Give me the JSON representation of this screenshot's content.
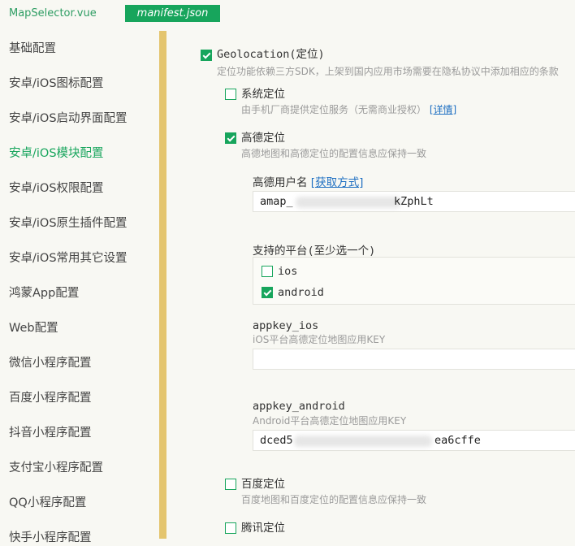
{
  "tabs": [
    "MapSelector.vue",
    "manifest.json"
  ],
  "sidebar": {
    "items": [
      "基础配置",
      "安卓/iOS图标配置",
      "安卓/iOS启动界面配置",
      "安卓/iOS模块配置",
      "安卓/iOS权限配置",
      "安卓/iOS原生插件配置",
      "安卓/iOS常用其它设置",
      "鸿蒙App配置",
      "Web配置",
      "微信小程序配置",
      "百度小程序配置",
      "抖音小程序配置",
      "支付宝小程序配置",
      "QQ小程序配置",
      "快手小程序配置"
    ],
    "active_index": 3
  },
  "geolocation": {
    "label": "Geolocation(定位)",
    "checked": true,
    "desc": "定位功能依赖三方SDK，上架到国内应用市场需要在隐私协议中添加相应的条款"
  },
  "system_location": {
    "label": "系统定位",
    "checked": false,
    "desc": "由手机厂商提供定位服务（无需商业授权）",
    "link": "[详情]"
  },
  "amap": {
    "label": "高德定位",
    "checked": true,
    "desc": "高德地图和高德定位的配置信息应保持一致",
    "username_label": "高德用户名",
    "username_link": "[获取方式]",
    "username_prefix": "amap_",
    "username_suffix": "kZphLt",
    "platforms_label": "支持的平台(至少选一个)",
    "platforms": [
      {
        "name": "ios",
        "checked": false
      },
      {
        "name": "android",
        "checked": true
      }
    ],
    "appkey_ios_label": "appkey_ios",
    "appkey_ios_desc": "iOS平台高德定位地图应用KEY",
    "appkey_ios_value": "",
    "appkey_android_label": "appkey_android",
    "appkey_android_desc": "Android平台高德定位地图应用KEY",
    "appkey_android_prefix": "dced5",
    "appkey_android_suffix": "ea6cffe"
  },
  "baidu": {
    "label": "百度定位",
    "checked": false,
    "desc": "百度地图和百度定位的配置信息应保持一致"
  },
  "tencent": {
    "label": "腾讯定位",
    "checked": false
  },
  "colors": {
    "accent": "#17a55c",
    "divider": "#e4c56e",
    "link": "#1e6fc2"
  }
}
